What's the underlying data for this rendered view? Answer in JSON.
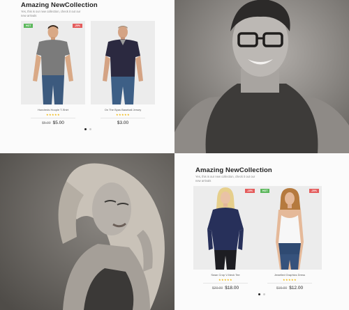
{
  "section_top": {
    "title": "Amazing NewCollection",
    "desc": "Yes, this is our new collection, check it out our new arrivals"
  },
  "section_bottom": {
    "title": "Amazing NewCollection",
    "desc": "Yes, this is our new collection, check it out our new arrivals"
  },
  "products_top": [
    {
      "name": "Hundreds Hoople T-Shirt",
      "old_price": "$5.00",
      "price": "$5.00",
      "badge_left": "HOT",
      "badge_right": "-20%",
      "stars": "★★★★★"
    },
    {
      "name": "On The Byas Baseball Jersey",
      "old_price": "",
      "price": "$3.00",
      "badge_left": "",
      "badge_right": "",
      "stars": "★★★★★"
    }
  ],
  "products_bottom": [
    {
      "name": "Swan Crop V-Neck Tee",
      "old_price": "$20.00",
      "price": "$18.00",
      "badge_left": "",
      "badge_right": "-10%",
      "stars": "★★★★★"
    },
    {
      "name": "Jewelled Graphics Dress",
      "old_price": "$15.00",
      "price": "$12.00",
      "badge_left": "HOT",
      "badge_right": "-20%",
      "stars": "★★★★★"
    }
  ],
  "colors": {
    "hot_badge": "#5cb85c",
    "sale_badge": "#e45c5c",
    "stars": "#f0b400"
  }
}
